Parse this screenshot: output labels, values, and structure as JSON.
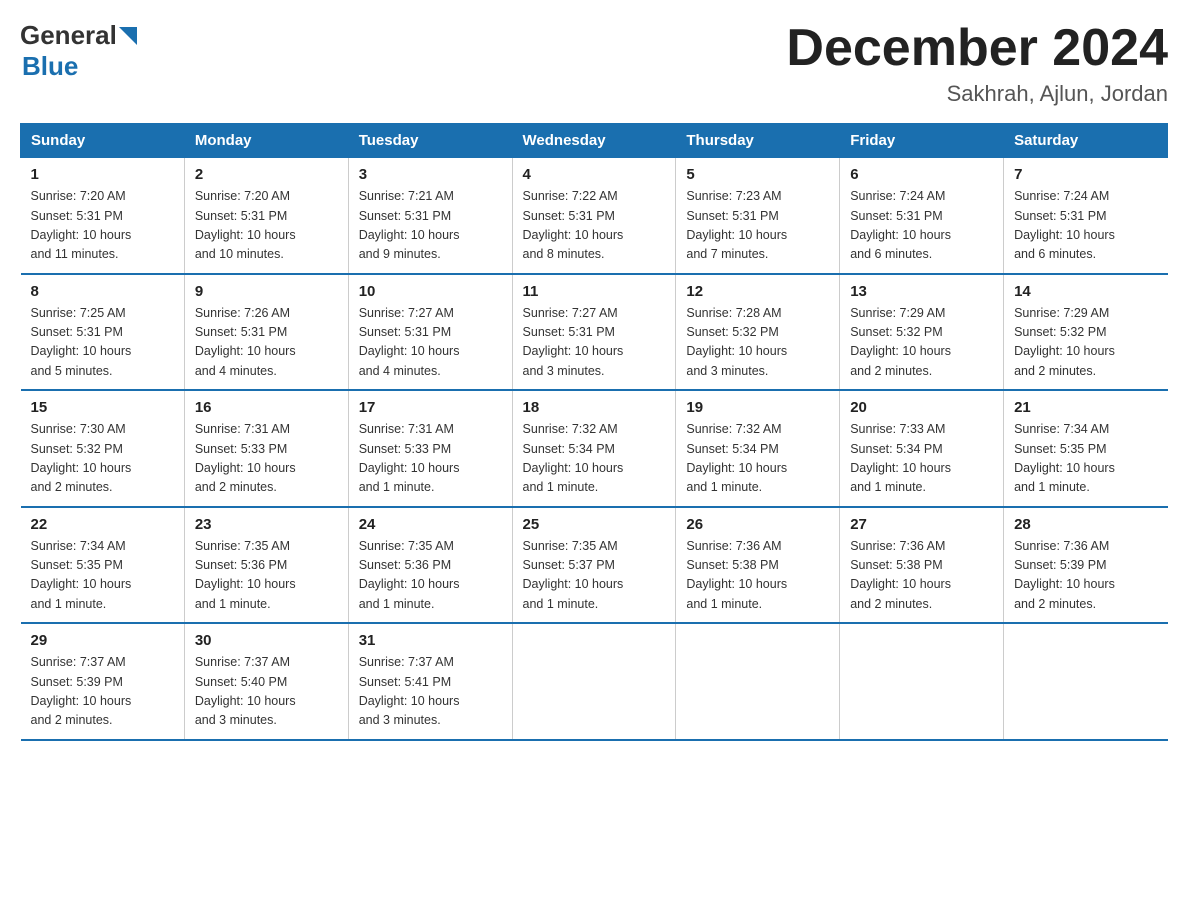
{
  "logo": {
    "general": "General",
    "blue": "Blue"
  },
  "title": "December 2024",
  "subtitle": "Sakhrah, Ajlun, Jordan",
  "days_of_week": [
    "Sunday",
    "Monday",
    "Tuesday",
    "Wednesday",
    "Thursday",
    "Friday",
    "Saturday"
  ],
  "weeks": [
    [
      {
        "day": "1",
        "sunrise": "7:20 AM",
        "sunset": "5:31 PM",
        "daylight": "10 hours and 11 minutes."
      },
      {
        "day": "2",
        "sunrise": "7:20 AM",
        "sunset": "5:31 PM",
        "daylight": "10 hours and 10 minutes."
      },
      {
        "day": "3",
        "sunrise": "7:21 AM",
        "sunset": "5:31 PM",
        "daylight": "10 hours and 9 minutes."
      },
      {
        "day": "4",
        "sunrise": "7:22 AM",
        "sunset": "5:31 PM",
        "daylight": "10 hours and 8 minutes."
      },
      {
        "day": "5",
        "sunrise": "7:23 AM",
        "sunset": "5:31 PM",
        "daylight": "10 hours and 7 minutes."
      },
      {
        "day": "6",
        "sunrise": "7:24 AM",
        "sunset": "5:31 PM",
        "daylight": "10 hours and 6 minutes."
      },
      {
        "day": "7",
        "sunrise": "7:24 AM",
        "sunset": "5:31 PM",
        "daylight": "10 hours and 6 minutes."
      }
    ],
    [
      {
        "day": "8",
        "sunrise": "7:25 AM",
        "sunset": "5:31 PM",
        "daylight": "10 hours and 5 minutes."
      },
      {
        "day": "9",
        "sunrise": "7:26 AM",
        "sunset": "5:31 PM",
        "daylight": "10 hours and 4 minutes."
      },
      {
        "day": "10",
        "sunrise": "7:27 AM",
        "sunset": "5:31 PM",
        "daylight": "10 hours and 4 minutes."
      },
      {
        "day": "11",
        "sunrise": "7:27 AM",
        "sunset": "5:31 PM",
        "daylight": "10 hours and 3 minutes."
      },
      {
        "day": "12",
        "sunrise": "7:28 AM",
        "sunset": "5:32 PM",
        "daylight": "10 hours and 3 minutes."
      },
      {
        "day": "13",
        "sunrise": "7:29 AM",
        "sunset": "5:32 PM",
        "daylight": "10 hours and 2 minutes."
      },
      {
        "day": "14",
        "sunrise": "7:29 AM",
        "sunset": "5:32 PM",
        "daylight": "10 hours and 2 minutes."
      }
    ],
    [
      {
        "day": "15",
        "sunrise": "7:30 AM",
        "sunset": "5:32 PM",
        "daylight": "10 hours and 2 minutes."
      },
      {
        "day": "16",
        "sunrise": "7:31 AM",
        "sunset": "5:33 PM",
        "daylight": "10 hours and 2 minutes."
      },
      {
        "day": "17",
        "sunrise": "7:31 AM",
        "sunset": "5:33 PM",
        "daylight": "10 hours and 1 minute."
      },
      {
        "day": "18",
        "sunrise": "7:32 AM",
        "sunset": "5:34 PM",
        "daylight": "10 hours and 1 minute."
      },
      {
        "day": "19",
        "sunrise": "7:32 AM",
        "sunset": "5:34 PM",
        "daylight": "10 hours and 1 minute."
      },
      {
        "day": "20",
        "sunrise": "7:33 AM",
        "sunset": "5:34 PM",
        "daylight": "10 hours and 1 minute."
      },
      {
        "day": "21",
        "sunrise": "7:34 AM",
        "sunset": "5:35 PM",
        "daylight": "10 hours and 1 minute."
      }
    ],
    [
      {
        "day": "22",
        "sunrise": "7:34 AM",
        "sunset": "5:35 PM",
        "daylight": "10 hours and 1 minute."
      },
      {
        "day": "23",
        "sunrise": "7:35 AM",
        "sunset": "5:36 PM",
        "daylight": "10 hours and 1 minute."
      },
      {
        "day": "24",
        "sunrise": "7:35 AM",
        "sunset": "5:36 PM",
        "daylight": "10 hours and 1 minute."
      },
      {
        "day": "25",
        "sunrise": "7:35 AM",
        "sunset": "5:37 PM",
        "daylight": "10 hours and 1 minute."
      },
      {
        "day": "26",
        "sunrise": "7:36 AM",
        "sunset": "5:38 PM",
        "daylight": "10 hours and 1 minute."
      },
      {
        "day": "27",
        "sunrise": "7:36 AM",
        "sunset": "5:38 PM",
        "daylight": "10 hours and 2 minutes."
      },
      {
        "day": "28",
        "sunrise": "7:36 AM",
        "sunset": "5:39 PM",
        "daylight": "10 hours and 2 minutes."
      }
    ],
    [
      {
        "day": "29",
        "sunrise": "7:37 AM",
        "sunset": "5:39 PM",
        "daylight": "10 hours and 2 minutes."
      },
      {
        "day": "30",
        "sunrise": "7:37 AM",
        "sunset": "5:40 PM",
        "daylight": "10 hours and 3 minutes."
      },
      {
        "day": "31",
        "sunrise": "7:37 AM",
        "sunset": "5:41 PM",
        "daylight": "10 hours and 3 minutes."
      },
      null,
      null,
      null,
      null
    ]
  ],
  "labels": {
    "sunrise": "Sunrise:",
    "sunset": "Sunset:",
    "daylight": "Daylight:"
  }
}
